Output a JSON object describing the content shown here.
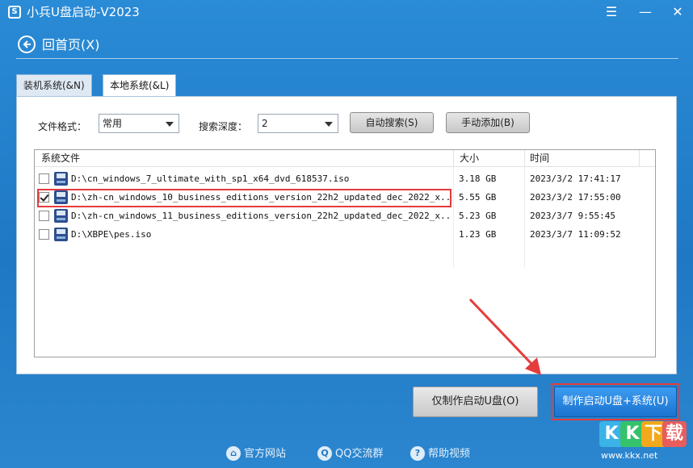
{
  "window": {
    "title": "小兵U盘启动-V2023",
    "logo_glyph": "S",
    "controls": {
      "menu": "☰",
      "minimize": "—",
      "close": "✕"
    }
  },
  "nav": {
    "back_label": "回首页(X)"
  },
  "tabs": [
    {
      "label": "装机系统(&N)",
      "active": false
    },
    {
      "label": "本地系统(&L)",
      "active": true
    }
  ],
  "filters": {
    "format_label": "文件格式：",
    "format_value": "常用",
    "depth_label": "搜索深度：",
    "depth_value": "2",
    "auto_search_label": "自动搜索(S)",
    "manual_add_label": "手动添加(B)"
  },
  "table": {
    "columns": [
      "系统文件",
      "大小",
      "时间"
    ],
    "rows": [
      {
        "checked": false,
        "name": "D:\\cn_windows_7_ultimate_with_sp1_x64_dvd_618537.iso",
        "size": "3.18 GB",
        "time": "2023/3/2 17:41:17"
      },
      {
        "checked": true,
        "name": "D:\\zh-cn_windows_10_business_editions_version_22h2_updated_dec_2022_x...",
        "size": "5.55 GB",
        "time": "2023/3/2 17:55:00"
      },
      {
        "checked": false,
        "name": "D:\\zh-cn_windows_11_business_editions_version_22h2_updated_dec_2022_x...",
        "size": "5.23 GB",
        "time": "2023/3/7 9:55:45"
      },
      {
        "checked": false,
        "name": "D:\\XBPE\\pes.iso",
        "size": "1.23 GB",
        "time": "2023/3/7 11:09:52"
      }
    ]
  },
  "actions": {
    "make_boot_only": "仅制作启动U盘(O)",
    "make_boot_and_system": "制作启动U盘+系统(U)"
  },
  "footer": [
    {
      "label": "官方网站",
      "icon": "home-icon",
      "glyph": "⌂"
    },
    {
      "label": "QQ交流群",
      "icon": "qq-icon",
      "glyph": "Q"
    },
    {
      "label": "帮助视频",
      "icon": "help-icon",
      "glyph": "?"
    }
  ],
  "watermark": {
    "letters": [
      "K",
      "K",
      "下",
      "载"
    ],
    "url": "www.kkx.net"
  },
  "colors": {
    "accent_blue": "#1f78c4",
    "highlight_red": "#e53c3c",
    "primary_button": "#1a73d0"
  }
}
